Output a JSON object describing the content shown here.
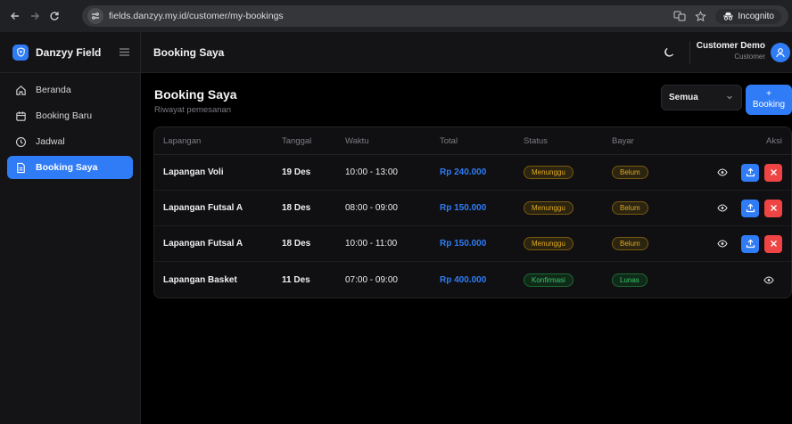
{
  "browser": {
    "url": "fields.danzyy.my.id/customer/my-bookings",
    "incognito_label": "Incognito"
  },
  "sidebar": {
    "brand": "Danzyy Field",
    "items": [
      {
        "label": "Beranda",
        "icon": "home-icon"
      },
      {
        "label": "Booking Baru",
        "icon": "calendar-icon"
      },
      {
        "label": "Jadwal",
        "icon": "clock-icon"
      },
      {
        "label": "Booking Saya",
        "icon": "document-icon",
        "active": true
      }
    ]
  },
  "header": {
    "title": "Booking Saya",
    "user_name": "Customer Demo",
    "user_role": "Customer"
  },
  "main": {
    "title": "Booking Saya",
    "subtitle": "Riwayat pemesanan",
    "filter_value": "Semua",
    "new_button_plus": "+",
    "new_button_label": "Booking"
  },
  "table": {
    "columns": [
      "Lapangan",
      "Tanggal",
      "Waktu",
      "Total",
      "Status",
      "Bayar",
      "Aksi"
    ],
    "rows": [
      {
        "lapangan": "Lapangan Voli",
        "tanggal": "19 Des",
        "waktu": "10:00 - 13:00",
        "total": "Rp 240.000",
        "status": "Menunggu",
        "bayar": "Belum"
      },
      {
        "lapangan": "Lapangan Futsal A",
        "tanggal": "18 Des",
        "waktu": "08:00 - 09:00",
        "total": "Rp 150.000",
        "status": "Menunggu",
        "bayar": "Belum"
      },
      {
        "lapangan": "Lapangan Futsal A",
        "tanggal": "18 Des",
        "waktu": "10:00 - 11:00",
        "total": "Rp 150.000",
        "status": "Menunggu",
        "bayar": "Belum"
      },
      {
        "lapangan": "Lapangan Basket",
        "tanggal": "11 Des",
        "waktu": "07:00 - 09:00",
        "total": "Rp 400.000",
        "status": "Konfirmasi",
        "bayar": "Lunas"
      }
    ]
  },
  "colors": {
    "accent": "#2f7cf6",
    "danger": "#ef4444",
    "pending": "#e0a920",
    "success": "#3fc46a"
  }
}
